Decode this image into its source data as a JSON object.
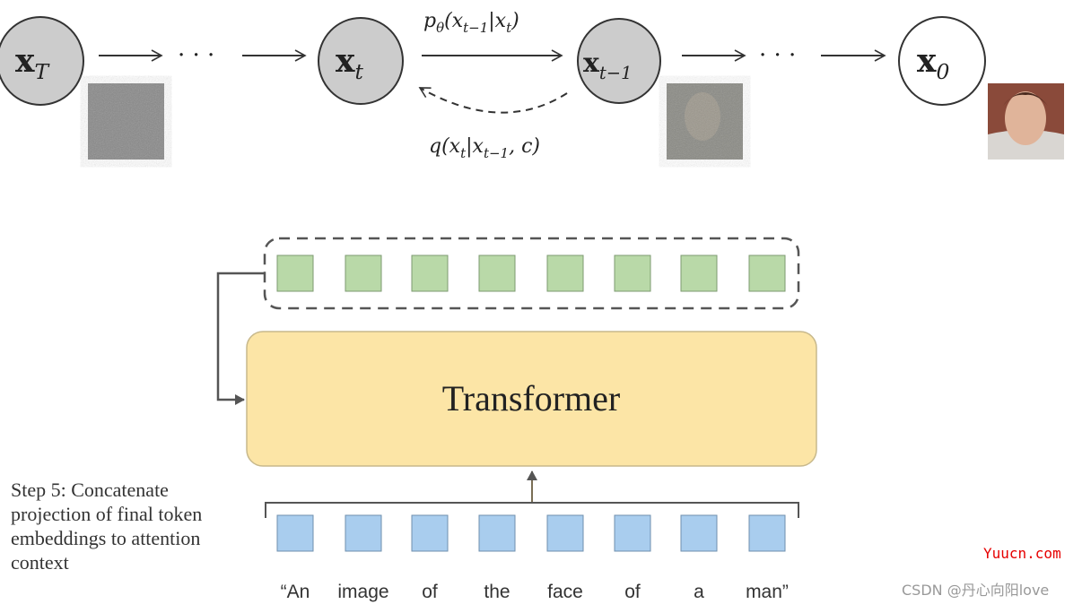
{
  "diffusion_chain": {
    "nodes": [
      {
        "base": "x",
        "sub": "T",
        "fill": "#cccccc"
      },
      {
        "base": "x",
        "sub": "t",
        "fill": "#cccccc"
      },
      {
        "base": "x",
        "sub": "t−1",
        "fill": "#cccccc"
      },
      {
        "base": "x",
        "sub": "0",
        "fill": "#ffffff"
      }
    ],
    "ellipsis": "· · ·",
    "reverse_label": [
      {
        "t": "p"
      },
      {
        "t": "θ",
        "sub": true
      },
      {
        "t": "(x"
      },
      {
        "t": "t−1",
        "sub": true
      },
      {
        "t": "|x"
      },
      {
        "t": "t",
        "sub": true
      },
      {
        "t": ")"
      }
    ],
    "forward_label": [
      {
        "t": "q(x"
      },
      {
        "t": "t",
        "sub": true
      },
      {
        "t": "|x"
      },
      {
        "t": "t−1",
        "sub": true
      },
      {
        "t": ", c)"
      }
    ]
  },
  "transformer": {
    "label": "Transformer",
    "fill": "#fce5a6",
    "output_token_color": "#b9d9a8",
    "input_token_color": "#a9cdee"
  },
  "caption": "Step 5: Concatenate projection of final token embeddings to attention context",
  "tokens": [
    "“An",
    "image",
    "of",
    "the",
    "face",
    "of",
    "a",
    "man”"
  ],
  "watermarks": {
    "site": "Yuucn.com",
    "author": "CSDN @丹心向阳love"
  }
}
